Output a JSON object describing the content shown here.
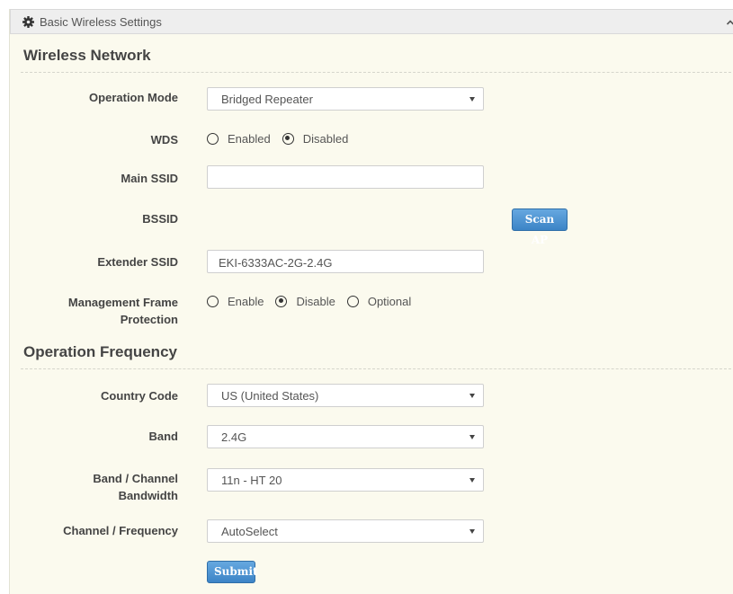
{
  "panel": {
    "title": "Basic Wireless Settings"
  },
  "wireless_network": {
    "title": "Wireless Network",
    "operation_mode": {
      "label": "Operation Mode",
      "value": "Bridged Repeater"
    },
    "wds": {
      "label": "WDS",
      "options": [
        "Enabled",
        "Disabled"
      ],
      "selected": "Disabled"
    },
    "main_ssid": {
      "label": "Main SSID",
      "value": ""
    },
    "bssid": {
      "label": "BSSID",
      "scan_button": "Scan AP"
    },
    "extender_ssid": {
      "label": "Extender SSID",
      "value": "EKI-6333AC-2G-2.4G"
    },
    "mfp": {
      "label_line1": "Management Frame",
      "label_line2": "Protection",
      "options": [
        "Enable",
        "Disable",
        "Optional"
      ],
      "selected": "Disable"
    }
  },
  "operation_frequency": {
    "title": "Operation Frequency",
    "country_code": {
      "label": "Country Code",
      "value": "US (United States)"
    },
    "band": {
      "label": "Band",
      "value": "2.4G"
    },
    "bandwidth": {
      "label_line1": "Band / Channel",
      "label_line2": "Bandwidth",
      "value": "11n - HT 20"
    },
    "channel": {
      "label": "Channel / Frequency",
      "value": "AutoSelect"
    }
  },
  "submit_label": "Submit",
  "colors": {
    "panel_bg": "#fbfaee",
    "header_bg": "#eeeeee",
    "button_blue": "#428bca"
  },
  "icons": {
    "header": "gear-icon",
    "collapse": "chevron-up-icon"
  }
}
